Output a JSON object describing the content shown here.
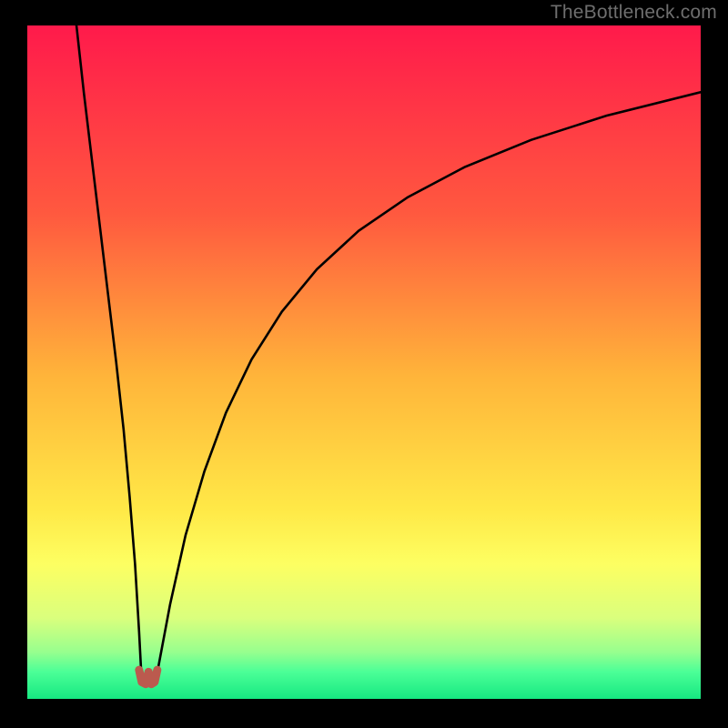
{
  "watermark": "TheBottleneck.com",
  "chart_data": {
    "type": "line",
    "title": "",
    "xlabel": "",
    "ylabel": "",
    "xlim": [
      0,
      100
    ],
    "ylim": [
      0,
      100
    ],
    "gradient_stops": [
      {
        "offset": 0,
        "color": "#ff1a4b"
      },
      {
        "offset": 28,
        "color": "#ff593f"
      },
      {
        "offset": 52,
        "color": "#ffb43a"
      },
      {
        "offset": 72,
        "color": "#ffe947"
      },
      {
        "offset": 80,
        "color": "#fdff62"
      },
      {
        "offset": 88,
        "color": "#daff7d"
      },
      {
        "offset": 93,
        "color": "#98ff8e"
      },
      {
        "offset": 96,
        "color": "#4bff97"
      },
      {
        "offset": 100,
        "color": "#16e881"
      }
    ],
    "series": [
      {
        "name": "left-branch",
        "x": [
          7.3,
          8.4,
          9.6,
          10.8,
          12.0,
          13.2,
          14.3,
          15.2,
          16.0,
          16.6,
          17.0
        ],
        "y": [
          100.0,
          90.0,
          80.0,
          70.0,
          60.0,
          50.0,
          40.0,
          30.0,
          20.0,
          10.0,
          2.3
        ]
      },
      {
        "name": "right-branch",
        "x": [
          19.0,
          21.2,
          23.5,
          26.3,
          29.5,
          33.3,
          37.8,
          43.0,
          49.2,
          56.5,
          65.0,
          74.8,
          86.0,
          100.0
        ],
        "y": [
          2.3,
          14.0,
          24.3,
          33.8,
          42.5,
          50.4,
          57.5,
          63.8,
          69.5,
          74.5,
          79.0,
          83.0,
          86.6,
          90.1
        ]
      },
      {
        "name": "trough-marker",
        "x": [
          16.6,
          17.0,
          17.6,
          18.0,
          18.4,
          18.9,
          19.3
        ],
        "y": [
          4.3,
          2.5,
          2.2,
          4.0,
          2.2,
          2.5,
          4.3
        ]
      }
    ],
    "trough_marker_color": "#bb5a4e"
  }
}
